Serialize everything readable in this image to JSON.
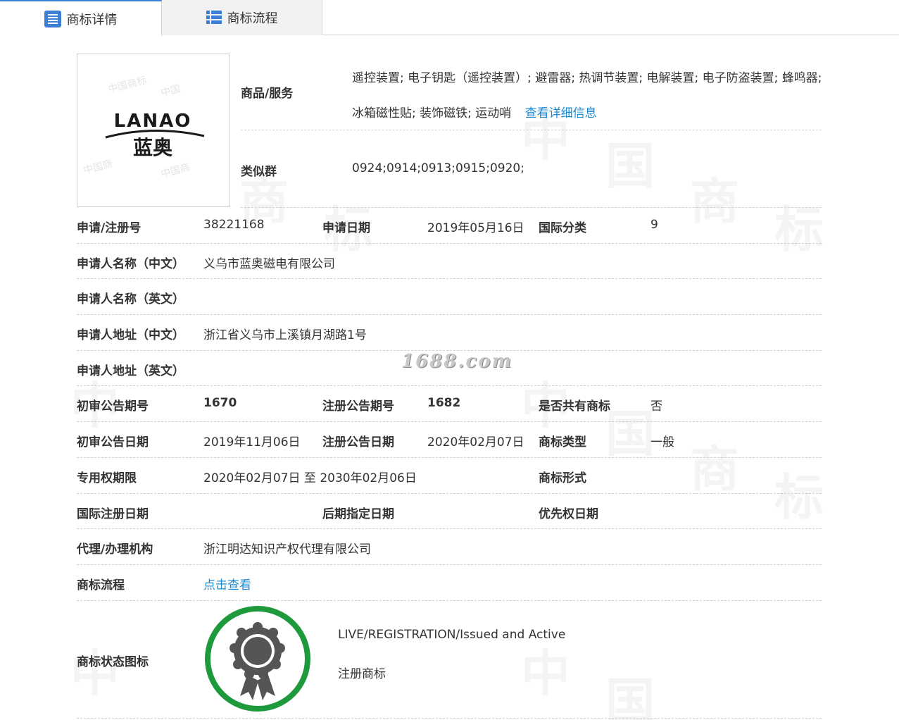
{
  "tabs": [
    {
      "label": "商标详情",
      "icon": "list-icon"
    },
    {
      "label": "商标流程",
      "icon": "table-icon"
    }
  ],
  "logo": {
    "text_en": "LANAO",
    "text_cn": "蓝奥"
  },
  "goods": {
    "label": "商品/服务",
    "value": "遥控装置; 电子钥匙（遥控装置）; 避雷器; 热调节装置; 电解装置; 电子防盗装置; 蜂鸣器; 冰箱磁性贴; 装饰磁铁; 运动哨",
    "link": "查看详细信息"
  },
  "similar": {
    "label": "类似群",
    "value": "0924;0914;0913;0915;0920;"
  },
  "rows": {
    "reg_no_label": "申请/注册号",
    "reg_no": "38221168",
    "app_date_label": "申请日期",
    "app_date": "2019年05月16日",
    "intl_class_label": "国际分类",
    "intl_class": "9",
    "applicant_cn_label": "申请人名称（中文）",
    "applicant_cn": "义乌市蓝奥磁电有限公司",
    "applicant_en_label": "申请人名称（英文）",
    "address_cn_label": "申请人地址（中文）",
    "address_cn": "浙江省义乌市上溪镇月湖路1号",
    "address_en_label": "申请人地址（英文）",
    "prelim_issue_label": "初审公告期号",
    "prelim_issue": "1670",
    "reg_issue_label": "注册公告期号",
    "reg_issue": "1682",
    "shared_label": "是否共有商标",
    "shared": "否",
    "prelim_date_label": "初审公告日期",
    "prelim_date": "2019年11月06日",
    "reg_date_label": "注册公告日期",
    "reg_date": "2020年02月07日",
    "type_label": "商标类型",
    "type": "一般",
    "term_label": "专用权期限",
    "term": "2020年02月07日 至 2030年02月06日",
    "form_label": "商标形式",
    "intl_reg_date_label": "国际注册日期",
    "later_date_label": "后期指定日期",
    "priority_label": "优先权日期",
    "agent_label": "代理/办理机构",
    "agent": "浙江明达知识产权代理有限公司",
    "flow_label": "商标流程",
    "flow_link": "点击查看",
    "status_label": "商标状态图标",
    "status_en": "LIVE/REGISTRATION/Issued and Active",
    "status_cn": "注册商标"
  },
  "watermark": {
    "site": "1688.com"
  },
  "colors": {
    "accent": "#3c7fd6",
    "link": "#1a8ad4",
    "status_ring": "#1e9a3c",
    "status_badge": "#555555"
  }
}
